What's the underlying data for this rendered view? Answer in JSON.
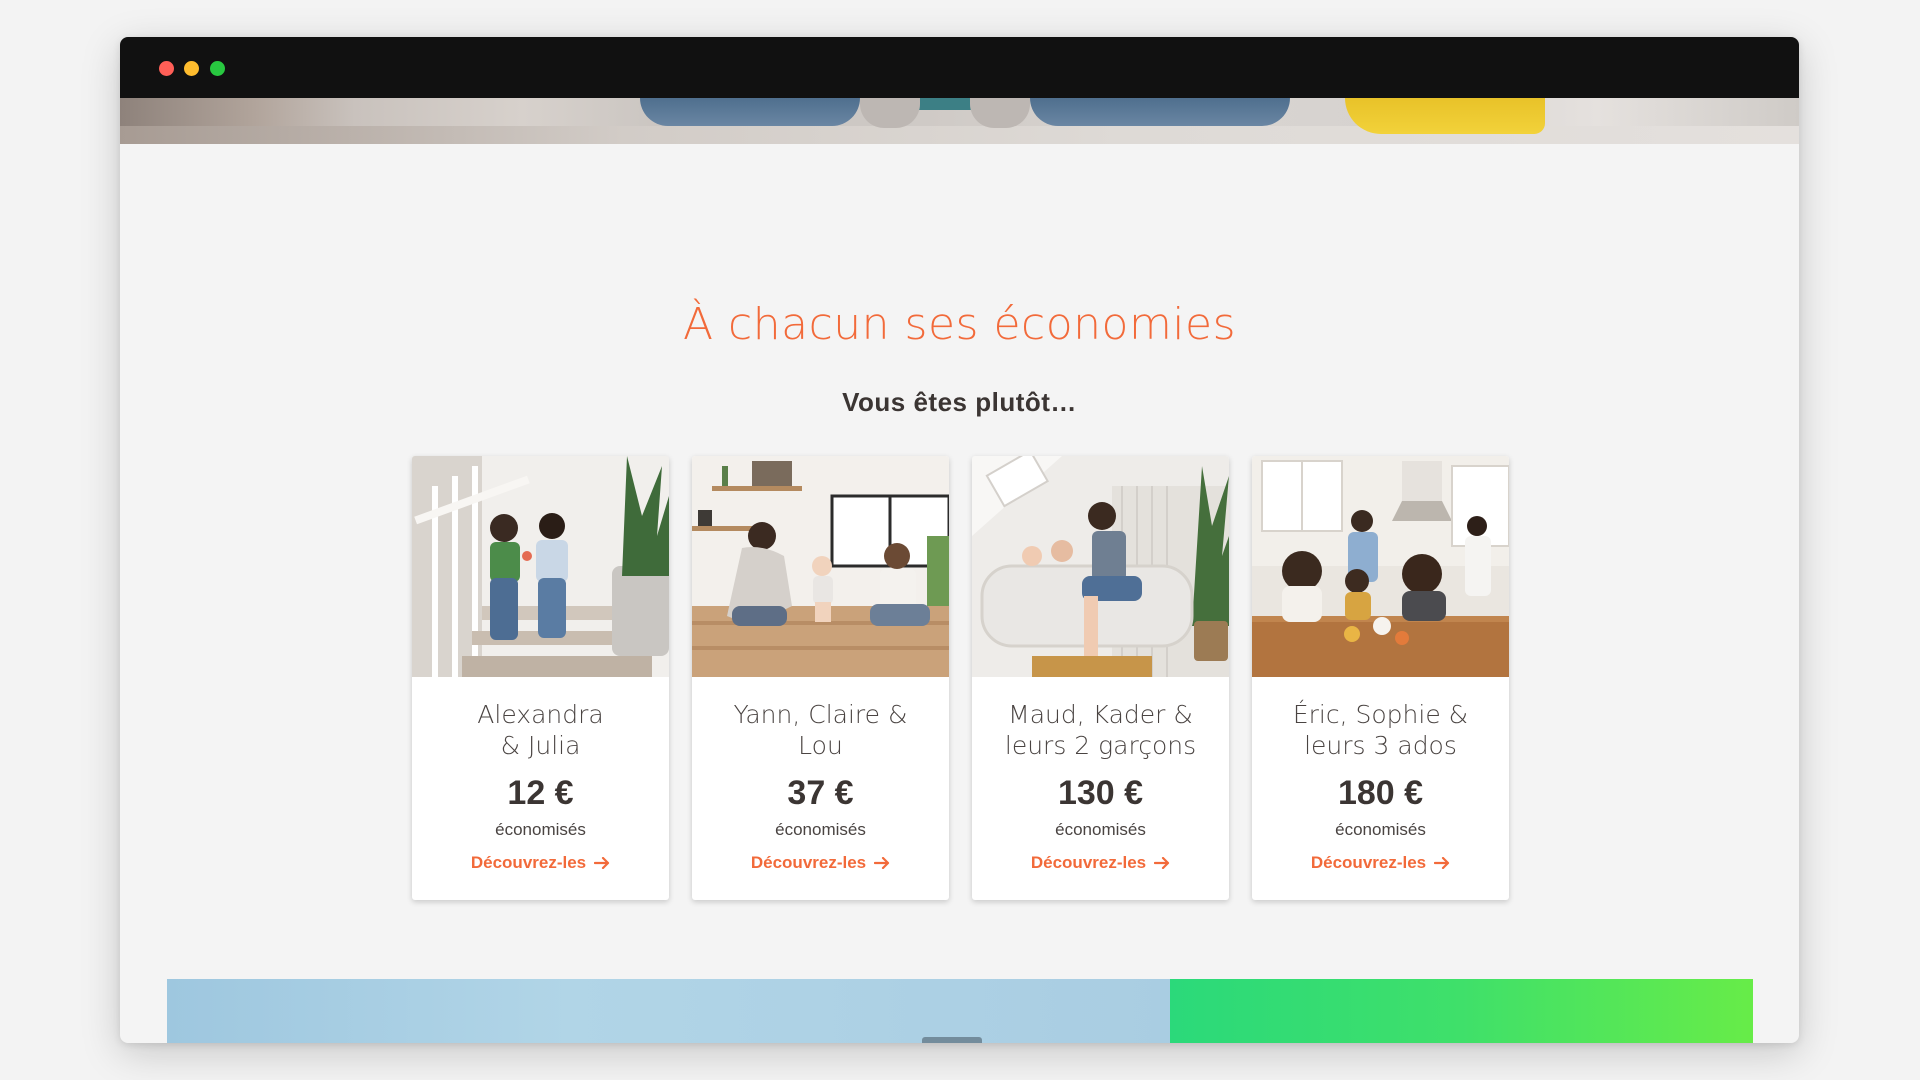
{
  "section": {
    "title": "À chacun ses économies",
    "subtitle": "Vous êtes plutôt…"
  },
  "cards": [
    {
      "name": "Alexandra\n& Julia",
      "amount": "12 €",
      "note": "économisés",
      "link": "Découvrez-les",
      "photo_icon": "two-women-on-stairs-photo"
    },
    {
      "name": "Yann, Claire &\nLou",
      "amount": "37 €",
      "note": "économisés",
      "link": "Découvrez-les",
      "photo_icon": "parents-with-toddler-photo"
    },
    {
      "name": "Maud, Kader &\nleurs 2 garçons",
      "amount": "130 €",
      "note": "économisés",
      "link": "Découvrez-les",
      "photo_icon": "father-kids-bathtub-photo"
    },
    {
      "name": "Éric, Sophie &\nleurs 3 ados",
      "amount": "180 €",
      "note": "économisés",
      "link": "Découvrez-les",
      "photo_icon": "family-kitchen-table-photo"
    }
  ],
  "colors": {
    "accent": "#f26a3a",
    "text_dark": "#3b3533",
    "window_bar": "#111111"
  }
}
